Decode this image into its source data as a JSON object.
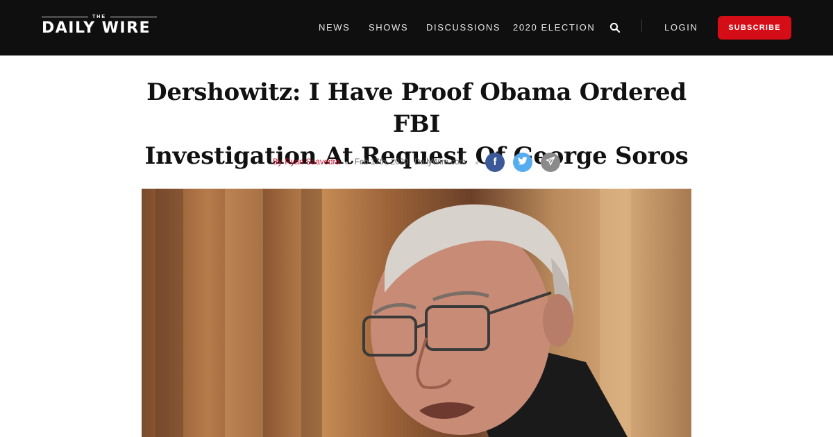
{
  "header": {
    "logo_the": "THE",
    "logo_name": "DAILY WIRE",
    "nav": [
      {
        "label": "NEWS"
      },
      {
        "label": "SHOWS"
      },
      {
        "label": "DISCUSSIONS"
      },
      {
        "label": "2020 ELECTION"
      }
    ],
    "search_icon": "search-icon",
    "login_label": "LOGIN",
    "subscribe_label": "SUBSCRIBE"
  },
  "article": {
    "title_line1": "Dershowitz: I Have Proof Obama Ordered FBI",
    "title_line2": "Investigation At Request Of George Soros",
    "by_label": "By",
    "author": "Ryan Saavedra",
    "date": "Feb 17th, 2020",
    "source": "DailyWire.com",
    "share": [
      {
        "network": "facebook",
        "icon": "facebook-icon",
        "color": "#3b5998",
        "glyph": "f"
      },
      {
        "network": "twitter",
        "icon": "twitter-icon",
        "color": "#55acee"
      },
      {
        "network": "email",
        "icon": "send-icon",
        "color": "#8a8a8a"
      }
    ]
  },
  "colors": {
    "header_bg": "#0f0f10",
    "accent_red": "#d50d17",
    "author_red": "#c8102e"
  }
}
